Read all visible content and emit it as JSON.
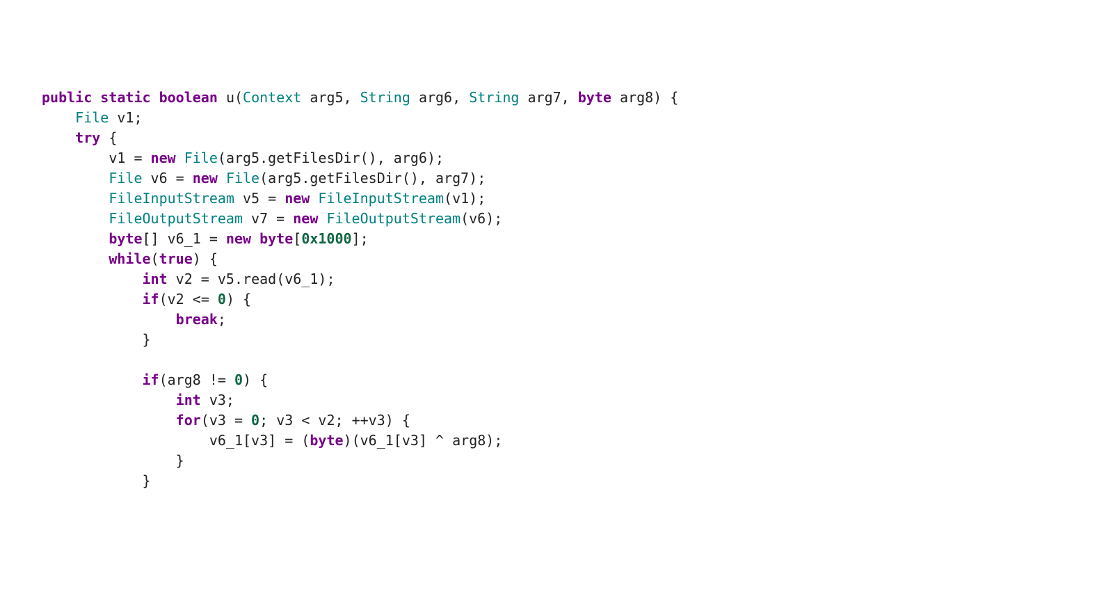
{
  "code": {
    "tokens": {
      "kw_public": "public",
      "kw_static": "static",
      "kw_boolean": "boolean",
      "kw_new": "new",
      "kw_try": "try",
      "kw_while": "while",
      "kw_true": "true",
      "kw_if": "if",
      "kw_int": "int",
      "kw_for": "for",
      "kw_break": "break",
      "kw_byte": "byte",
      "type_context": "Context",
      "type_string": "String",
      "type_file": "File",
      "type_fis": "FileInputStream",
      "type_fos": "FileOutputStream",
      "num_0x1000": "0x1000",
      "num_0": "0",
      "fn_u": "u",
      "id_arg5": "arg5",
      "id_arg6": "arg6",
      "id_arg7": "arg7",
      "id_arg8": "arg8",
      "id_v1": "v1",
      "id_v6": "v6",
      "id_v5": "v5",
      "id_v7": "v7",
      "id_v6_1": "v6_1",
      "id_v2": "v2",
      "id_v3": "v3",
      "m_getFilesDir": "getFilesDir",
      "m_read": "read"
    }
  }
}
